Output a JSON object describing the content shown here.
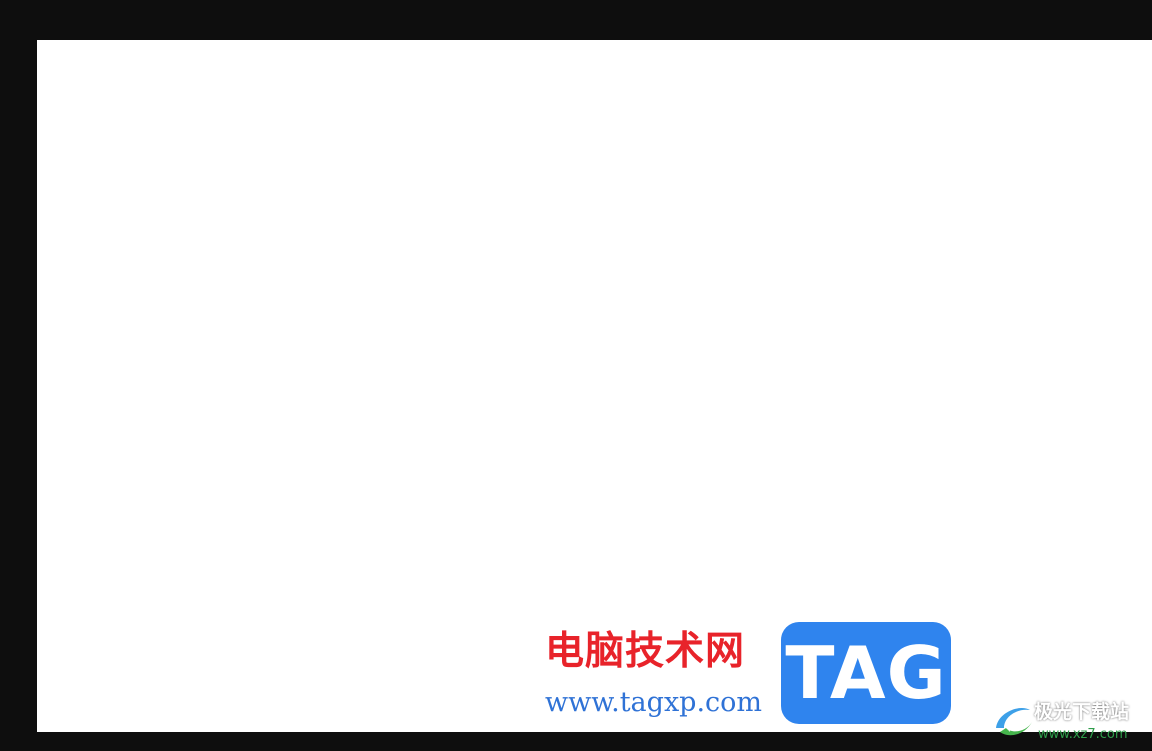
{
  "watermark": {
    "site_name": "电脑技术网",
    "site_url": "www.tagxp.com",
    "tag_logo": "TAG",
    "colors": {
      "site_name": "#e8232a",
      "site_url": "#2f72d6",
      "tag_bg": "#2f84ee"
    }
  },
  "corner_logo": {
    "title": "极光下载站",
    "subtitle": "www.xz7.com",
    "icon": "swirl-logo-icon"
  },
  "colors": {
    "background": "#0e0e0e",
    "canvas": "#ffffff"
  }
}
